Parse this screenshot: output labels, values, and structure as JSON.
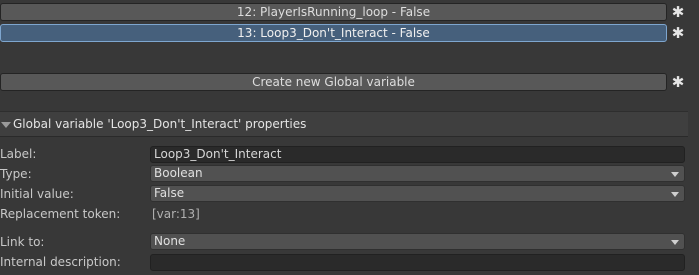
{
  "variables_list": {
    "items": [
      {
        "label": "12: PlayerIsRunning_loop - False",
        "selected": false
      },
      {
        "label": "13: Loop3_Don't_Interact - False",
        "selected": true
      }
    ],
    "gear_icon": "gear-icon"
  },
  "create_button": {
    "label": "Create new Global variable",
    "gear_icon": "gear-icon"
  },
  "properties": {
    "header_title": "Global variable 'Loop3_Don't_Interact' properties",
    "fields": {
      "label": {
        "caption": "Label:",
        "value": "Loop3_Don't_Interact"
      },
      "type": {
        "caption": "Type:",
        "value": "Boolean"
      },
      "initial_value": {
        "caption": "Initial value:",
        "value": "False"
      },
      "replacement_token": {
        "caption": "Replacement token:",
        "value": "[var:13]"
      },
      "link_to": {
        "caption": "Link to:",
        "value": "None"
      },
      "internal_description": {
        "caption": "Internal description:",
        "value": ""
      }
    }
  },
  "colors": {
    "background": "#383838",
    "selected_row": "#46607c",
    "button": "#585858",
    "text_field": "#2a2a2a"
  }
}
